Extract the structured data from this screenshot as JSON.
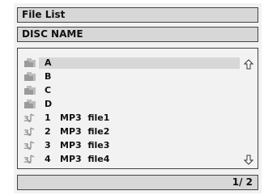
{
  "header": {
    "title": "File List"
  },
  "disc": {
    "name": "DISC NAME"
  },
  "folders": [
    {
      "label": "A",
      "icon": "folder-icon",
      "selected": true
    },
    {
      "label": "B",
      "icon": "folder-icon"
    },
    {
      "label": "C",
      "icon": "folder-icon"
    },
    {
      "label": "D",
      "icon": "folder-icon"
    }
  ],
  "files": [
    {
      "number": "1",
      "name": "MP3  file1",
      "icon": "music-note-icon"
    },
    {
      "number": "2",
      "name": "MP3  file2",
      "icon": "music-note-icon"
    },
    {
      "number": "3",
      "name": "MP3  file3",
      "icon": "music-note-icon"
    },
    {
      "number": "4",
      "name": "MP3  file4",
      "icon": "music-note-icon"
    }
  ],
  "scroll": {
    "up_icon": "arrow-up-icon",
    "down_icon": "arrow-down-icon"
  },
  "pagination": {
    "text": "1/ 2"
  },
  "colors": {
    "panel": "#f2f2f2",
    "bar": "#d7d7d7",
    "border": "#444444",
    "icon": "#b8b8b8"
  }
}
